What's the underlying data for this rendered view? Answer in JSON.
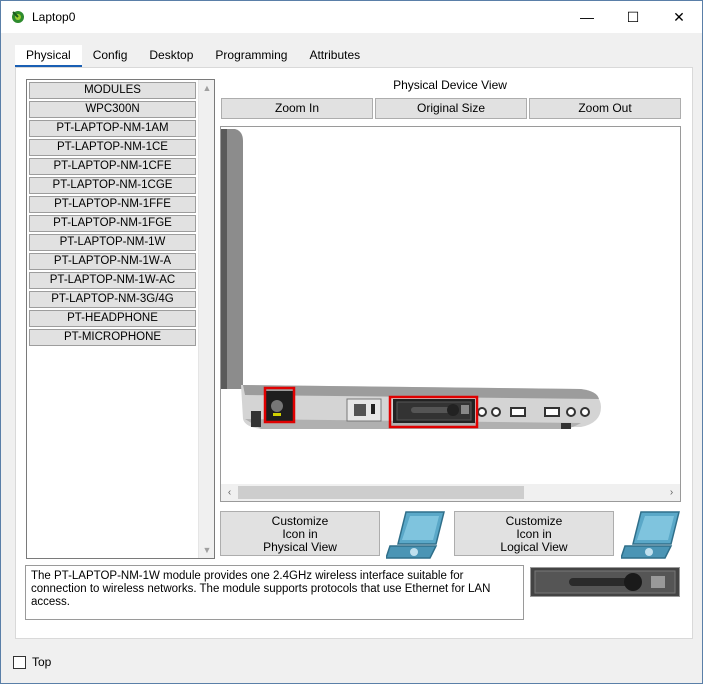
{
  "window": {
    "title": "Laptop0",
    "controls": {
      "minimize": "—",
      "maximize": "☐",
      "close": "✕"
    }
  },
  "tabs": [
    {
      "label": "Physical",
      "active": true
    },
    {
      "label": "Config",
      "active": false
    },
    {
      "label": "Desktop",
      "active": false
    },
    {
      "label": "Programming",
      "active": false
    },
    {
      "label": "Attributes",
      "active": false
    }
  ],
  "modules": {
    "items": [
      "MODULES",
      "WPC300N",
      "PT-LAPTOP-NM-1AM",
      "PT-LAPTOP-NM-1CE",
      "PT-LAPTOP-NM-1CFE",
      "PT-LAPTOP-NM-1CGE",
      "PT-LAPTOP-NM-1FFE",
      "PT-LAPTOP-NM-1FGE",
      "PT-LAPTOP-NM-1W",
      "PT-LAPTOP-NM-1W-A",
      "PT-LAPTOP-NM-1W-AC",
      "PT-LAPTOP-NM-3G/4G",
      "PT-HEADPHONE",
      "PT-MICROPHONE"
    ]
  },
  "device_view": {
    "title": "Physical Device View",
    "zoom_in": "Zoom In",
    "original_size": "Original Size",
    "zoom_out": "Zoom Out"
  },
  "customize": {
    "physical": [
      "Customize",
      "Icon in",
      "Physical View"
    ],
    "logical": [
      "Customize",
      "Icon in",
      "Logical View"
    ]
  },
  "description": "The PT-LAPTOP-NM-1W module provides one 2.4GHz wireless interface suitable for connection to wireless networks. The module supports protocols that use Ethernet for LAN access.",
  "footer": {
    "top_label": "Top",
    "top_checked": false
  },
  "colors": {
    "accent": "#1a5fb4",
    "highlight": "#e00000"
  }
}
